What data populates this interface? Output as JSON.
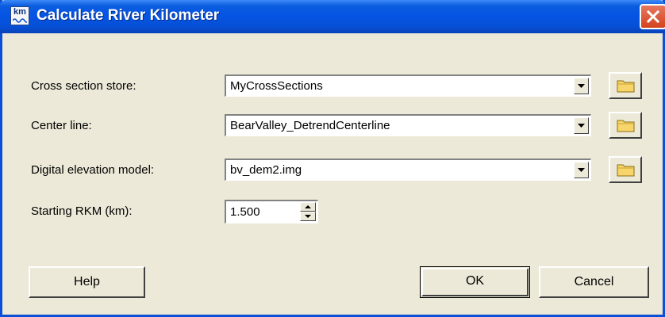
{
  "window": {
    "title": "Calculate River Kilometer",
    "icon": "km-ruler-icon",
    "icon_text": "km"
  },
  "fields": [
    {
      "label": "Cross section store:",
      "value": "MyCrossSections"
    },
    {
      "label": "Center line:",
      "value": "BearValley_DetrendCenterline"
    },
    {
      "label": "Digital elevation model:",
      "value": "bv_dem2.img"
    }
  ],
  "starting_rkm": {
    "label": "Starting RKM (km):",
    "value": "1.500"
  },
  "buttons": {
    "help": "Help",
    "ok": "OK",
    "cancel": "Cancel"
  },
  "colors": {
    "titlebar": "#0554e3",
    "close": "#d3431f",
    "face": "#ece9d8",
    "folder": "#f7d56a"
  }
}
